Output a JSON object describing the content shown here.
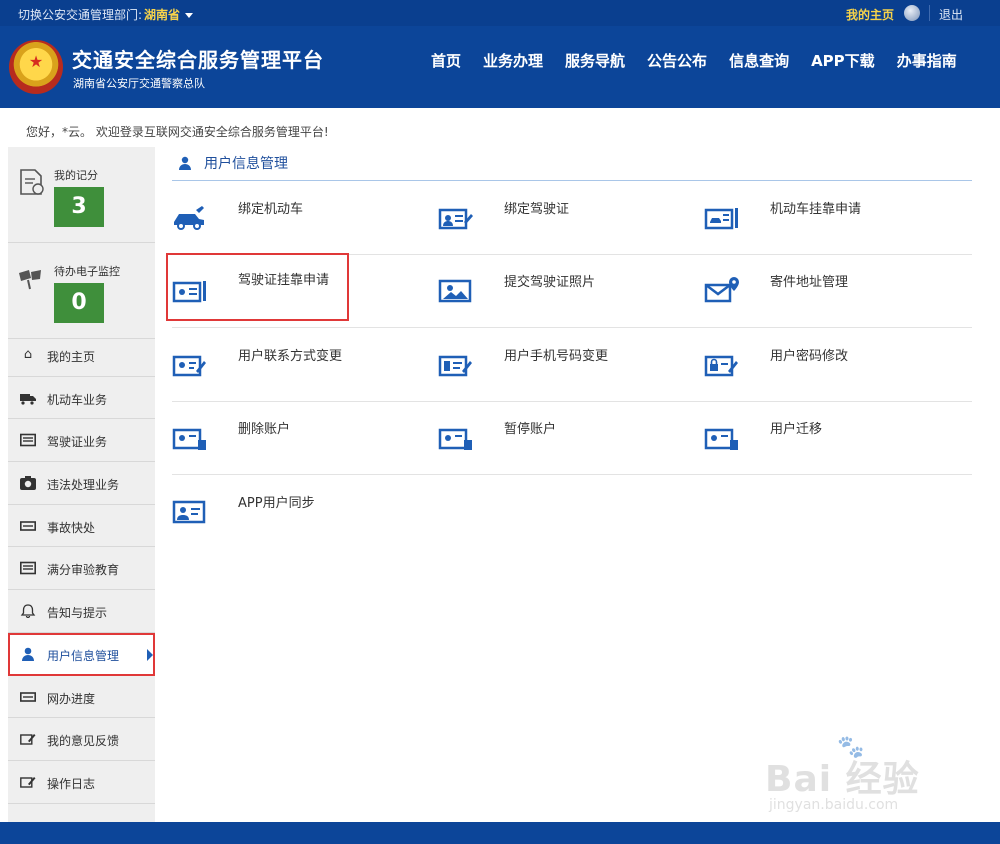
{
  "topbar": {
    "switch_label": "切换公安交通管理部门:",
    "province": "湖南省",
    "my_home": "我的主页",
    "logout": "退出"
  },
  "header": {
    "title": "交通安全综合服务管理平台",
    "subtitle": "湖南省公安厅交通警察总队",
    "nav": [
      "首页",
      "业务办理",
      "服务导航",
      "公告公布",
      "信息查询",
      "APP下载",
      "办事指南"
    ]
  },
  "greeting": "您好，*云。 欢迎登录互联网交通安全综合服务管理平台!",
  "sidebar": {
    "score": {
      "label": "我的记分",
      "value": "3"
    },
    "monitor": {
      "label": "待办电子监控",
      "value": "0"
    },
    "items": [
      {
        "label": "我的主页",
        "icon": "home-icon"
      },
      {
        "label": "机动车业务",
        "icon": "truck-icon"
      },
      {
        "label": "驾驶证业务",
        "icon": "card-icon"
      },
      {
        "label": "违法处理业务",
        "icon": "camera-icon"
      },
      {
        "label": "事故快处",
        "icon": "car-card-icon"
      },
      {
        "label": "满分审验教育",
        "icon": "card-icon"
      },
      {
        "label": "告知与提示",
        "icon": "bell-icon"
      },
      {
        "label": "用户信息管理",
        "icon": "user-icon"
      },
      {
        "label": "网办进度",
        "icon": "progress-icon"
      },
      {
        "label": "我的意见反馈",
        "icon": "feedback-icon"
      },
      {
        "label": "操作日志",
        "icon": "log-icon"
      }
    ]
  },
  "content": {
    "section_title": "用户信息管理",
    "rows": [
      [
        "绑定机动车",
        "绑定驾驶证",
        "机动车挂靠申请"
      ],
      [
        "驾驶证挂靠申请",
        "提交驾驶证照片",
        "寄件地址管理"
      ],
      [
        "用户联系方式变更",
        "用户手机号码变更",
        "用户密码修改"
      ],
      [
        "删除账户",
        "暂停账户",
        "用户迁移"
      ],
      [
        "APP用户同步"
      ]
    ]
  },
  "watermark": {
    "brand": "Bai 经验",
    "url": "jingyan.baidu.com"
  },
  "colors": {
    "header_bg": "#0c4599",
    "accent": "#1f5fb6",
    "score_green": "#3f8f3b",
    "highlight_red": "#e03838"
  }
}
